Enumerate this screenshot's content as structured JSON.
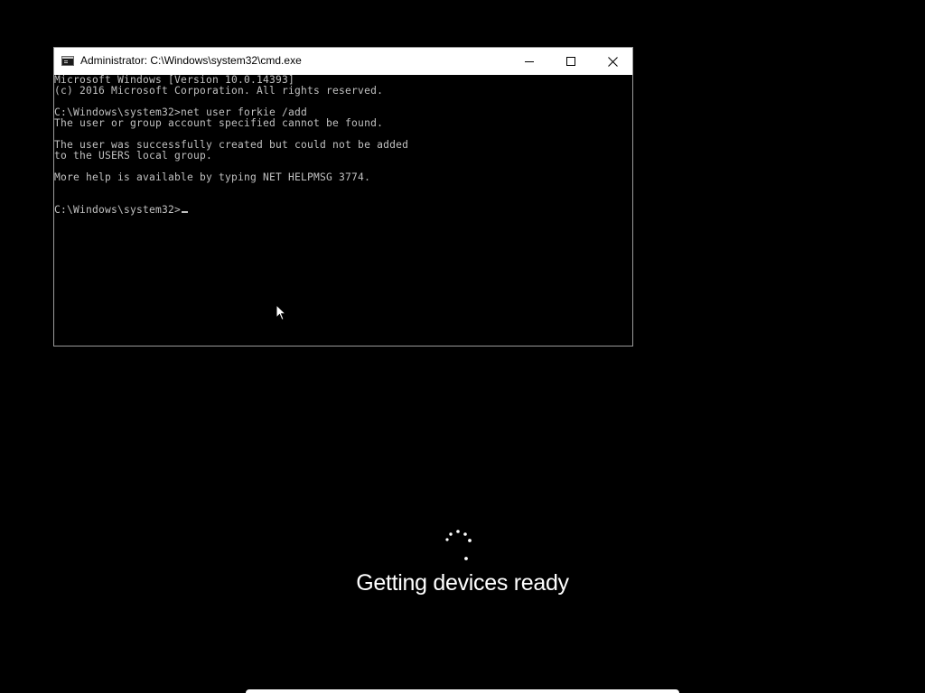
{
  "window": {
    "title": "Administrator: C:\\Windows\\system32\\cmd.exe",
    "icon": "cmd-app-icon",
    "controls": [
      "minimize",
      "maximize",
      "close"
    ]
  },
  "console": {
    "lines": [
      "Microsoft Windows [Version 10.0.14393]",
      "(c) 2016 Microsoft Corporation. All rights reserved.",
      "",
      "C:\\Windows\\system32>net user forkie /add",
      "The user or group account specified cannot be found.",
      "",
      "The user was successfully created but could not be added",
      "to the USERS local group.",
      "",
      "More help is available by typing NET HELPMSG 3774.",
      "",
      "",
      "C:\\Windows\\system32>"
    ],
    "text_color": "#c0c0c0",
    "background": "#000000"
  },
  "setup": {
    "status": "Getting devices ready"
  },
  "colors": {
    "desktop": "#000000",
    "titlebar": "#ffffff",
    "status_text": "#ffffff"
  }
}
